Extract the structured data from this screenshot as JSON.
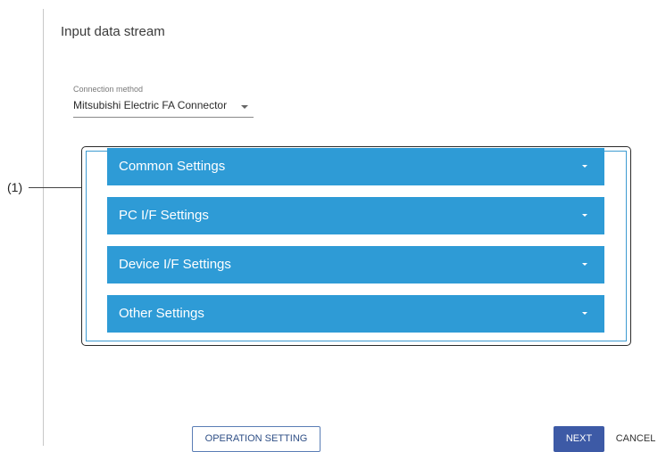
{
  "page": {
    "title": "Input data stream"
  },
  "connection": {
    "label": "Connection method",
    "value": "Mitsubishi Electric FA Connector"
  },
  "callout": {
    "label": "(1)"
  },
  "panels": [
    {
      "label": "Common Settings"
    },
    {
      "label": "PC I/F Settings"
    },
    {
      "label": "Device I/F Settings"
    },
    {
      "label": "Other Settings"
    }
  ],
  "footer": {
    "operation_setting_label": "OPERATION SETTING",
    "next_label": "NEXT",
    "cancel_label": "CANCEL"
  },
  "colors": {
    "panel_bg": "#2e9bd6",
    "next_bg": "#3d5aa6",
    "frame_inner": "#3d9bd1"
  },
  "icons": {
    "dropdown": "chevron-down-icon",
    "panel_expand": "expand-caret-icon"
  }
}
